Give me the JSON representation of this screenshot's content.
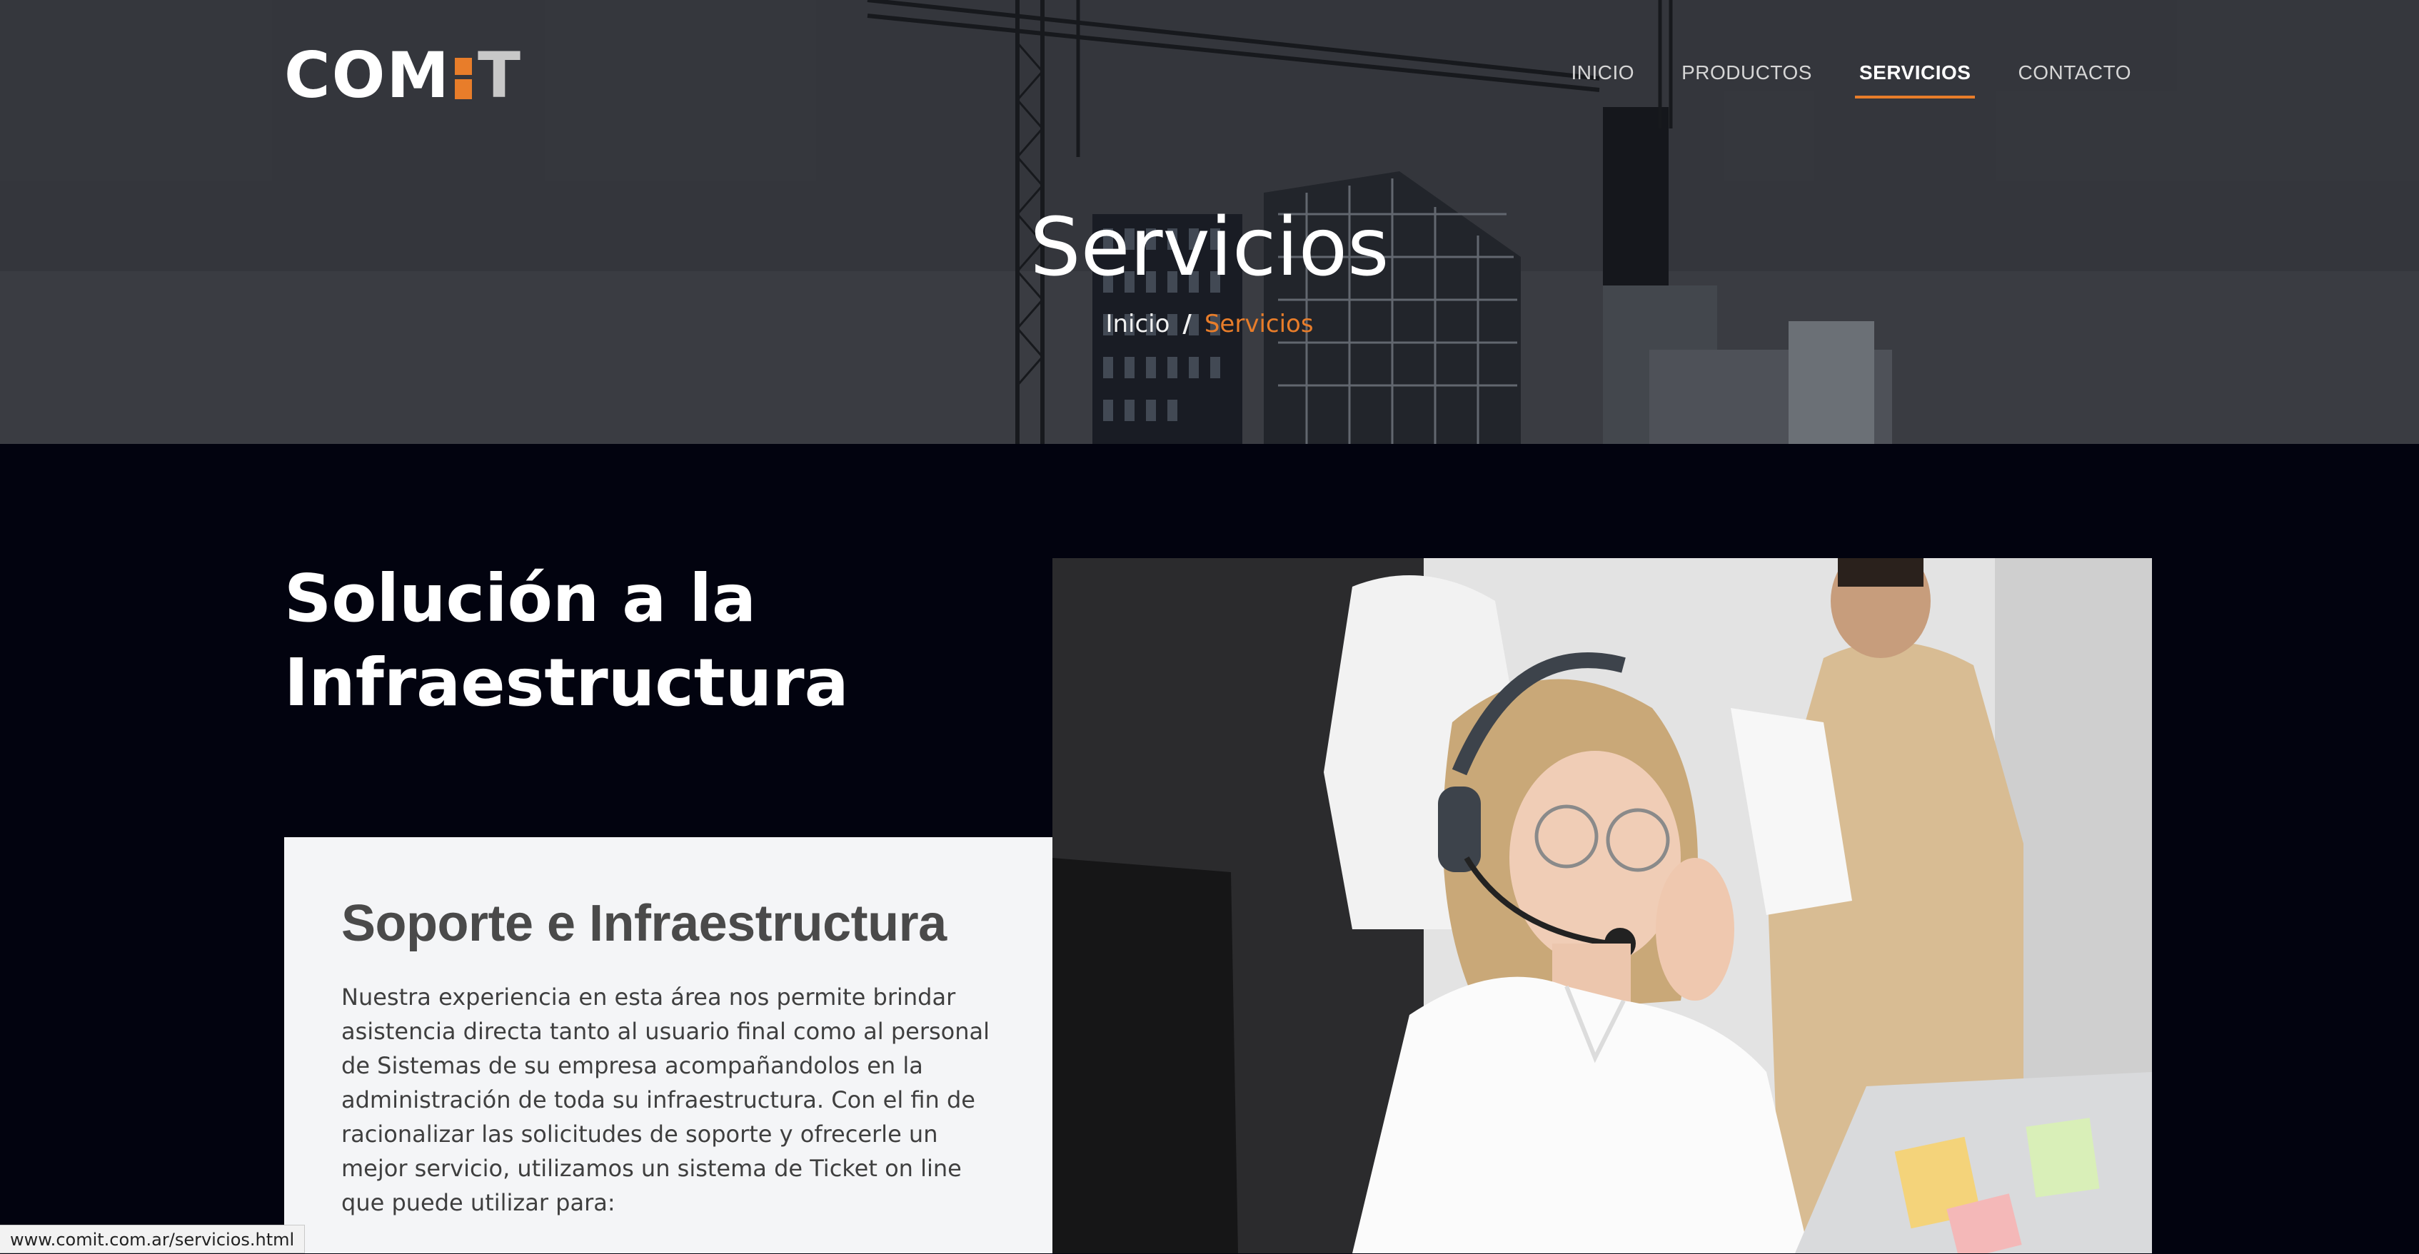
{
  "brand": {
    "logo_co": "CO",
    "logo_m": "M",
    "logo_t": "T",
    "accent_color": "#e87d2a"
  },
  "nav": {
    "items": [
      {
        "label": "INICIO"
      },
      {
        "label": "PRODUCTOS"
      },
      {
        "label": "SERVICIOS",
        "active": true
      },
      {
        "label": "CONTACTO"
      }
    ]
  },
  "hero": {
    "title": "Servicios",
    "breadcrumb": {
      "home": "Inicio",
      "separator": "/",
      "current": "Servicios"
    }
  },
  "section": {
    "heading_line1": "Solución a la",
    "heading_line2": "Infraestructura"
  },
  "card": {
    "title": "Soporte e Infraestructura",
    "body": "Nuestra experiencia en esta área nos permite brindar asistencia directa tanto al usuario final como al personal de Sistemas de su empresa acompañandolos en la administración de toda su infraestructura. Con el fin de racionalizar las solicitudes de soporte y ofrecerle un mejor servicio, utilizamos un sistema de Ticket on line que puede utilizar para:"
  },
  "status_bar": {
    "url": "www.comit.com.ar/servicios.html"
  }
}
